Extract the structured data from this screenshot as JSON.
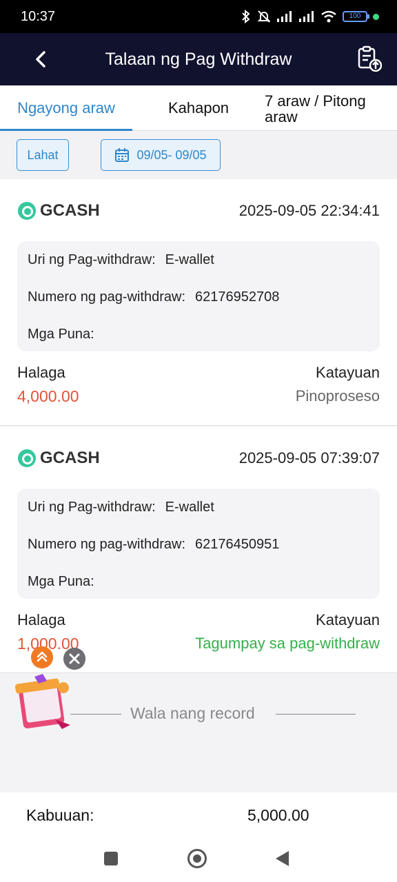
{
  "status_bar": {
    "time": "10:37",
    "battery": "100"
  },
  "header": {
    "title": "Talaan ng Pag Withdraw"
  },
  "tabs": [
    {
      "label": "Ngayong araw",
      "active": true
    },
    {
      "label": "Kahapon",
      "active": false
    },
    {
      "label": "7 araw / Pitong araw",
      "active": false
    }
  ],
  "filters": {
    "all_label": "Lahat",
    "date_range": "09/05- 09/05"
  },
  "records": [
    {
      "brand": "GCASH",
      "timestamp": "2025-09-05 22:34:41",
      "type_label": "Uri ng Pag-withdraw:",
      "type_value": "E-wallet",
      "number_label": "Numero ng pag-withdraw:",
      "number_value": "62176952708",
      "remarks_label": "Mga Puna:",
      "remarks_value": "",
      "amount_label": "Halaga",
      "amount": "4,000.00",
      "status_label": "Katayuan",
      "status": "Pinoproseso"
    },
    {
      "brand": "GCASH",
      "timestamp": "2025-09-05 07:39:07",
      "type_label": "Uri ng Pag-withdraw:",
      "type_value": "E-wallet",
      "number_label": "Numero ng pag-withdraw:",
      "number_value": "62176450951",
      "remarks_label": "Mga Puna:",
      "remarks_value": "",
      "amount_label": "Halaga",
      "amount": "1,000.00",
      "status_label": "Katayuan",
      "status": "Tagumpay sa pag-withdraw"
    }
  ],
  "empty_state": "Wala nang record",
  "total": {
    "label": "Kabuuan:",
    "value": "5,000.00"
  },
  "colors": {
    "header_bg": "#11122e",
    "accent": "#2f86c9",
    "amount": "#e05438",
    "success": "#34b049"
  },
  "icons": [
    "bluetooth-icon",
    "mute-icon",
    "signal-icon",
    "wifi-icon",
    "battery-icon",
    "back-icon",
    "record-upload-icon",
    "calendar-icon",
    "gcash-logo-icon",
    "scroll-top-icon",
    "close-icon",
    "gift-icon"
  ]
}
